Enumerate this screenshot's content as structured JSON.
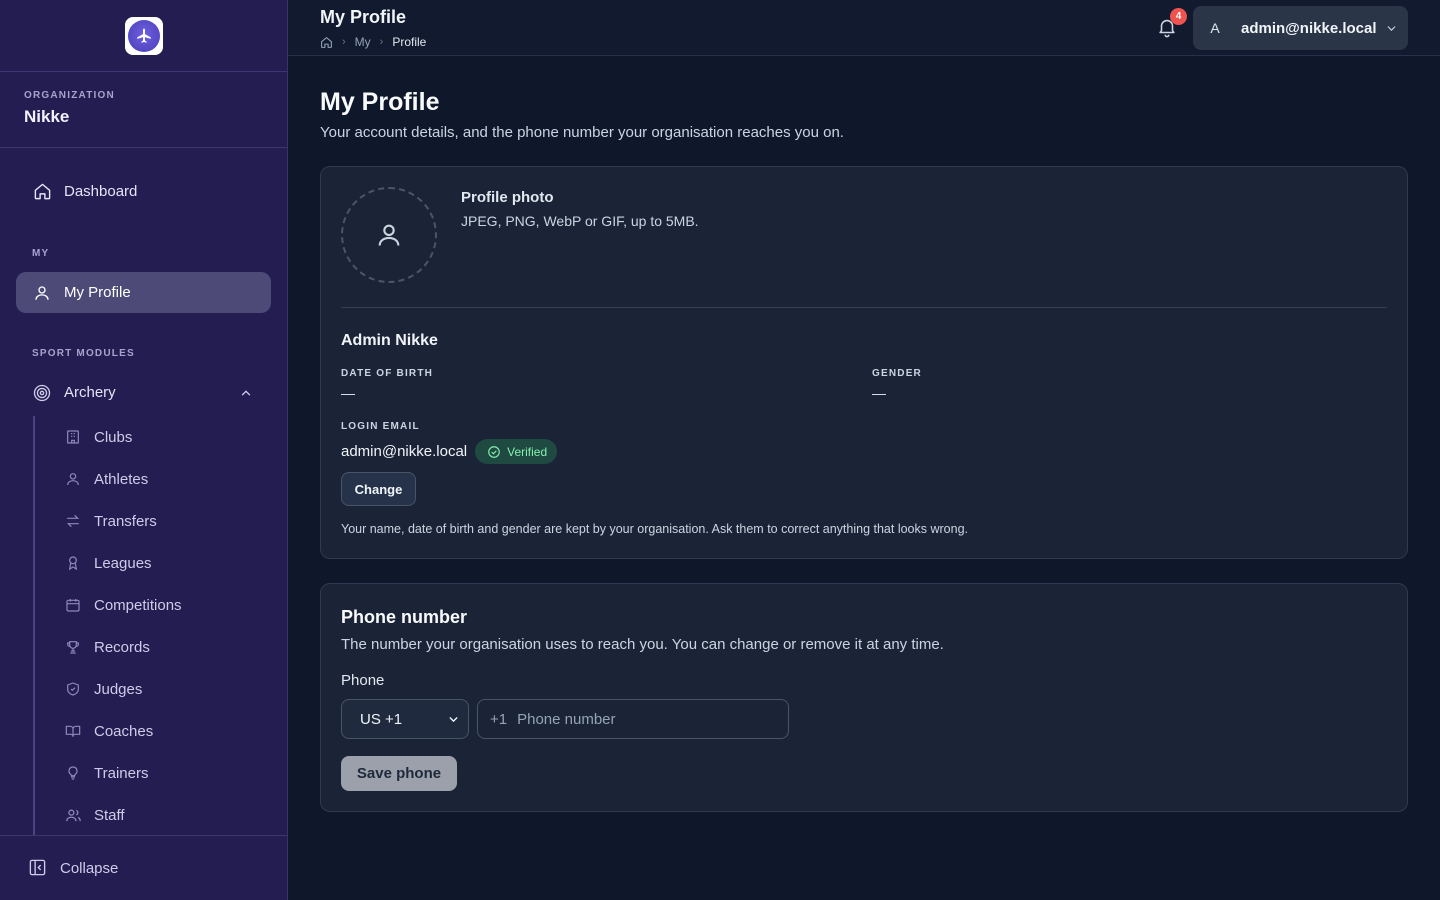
{
  "sidebar": {
    "org_label": "ORGANIZATION",
    "org_name": "Nikke",
    "dashboard": "Dashboard",
    "section_my": "MY",
    "my_profile": "My Profile",
    "section_sport": "SPORT MODULES",
    "archery": "Archery",
    "sub_items": [
      {
        "label": "Clubs",
        "icon": "building-icon"
      },
      {
        "label": "Athletes",
        "icon": "user-icon"
      },
      {
        "label": "Transfers",
        "icon": "arrows-icon"
      },
      {
        "label": "Leagues",
        "icon": "award-icon"
      },
      {
        "label": "Competitions",
        "icon": "calendar-icon"
      },
      {
        "label": "Records",
        "icon": "trophy-icon"
      },
      {
        "label": "Judges",
        "icon": "shield-icon"
      },
      {
        "label": "Coaches",
        "icon": "book-icon"
      },
      {
        "label": "Trainers",
        "icon": "lightbulb-icon"
      },
      {
        "label": "Staff",
        "icon": "users-icon"
      }
    ],
    "collapse": "Collapse"
  },
  "header": {
    "title": "My Profile",
    "breadcrumb": [
      "My",
      "Profile"
    ],
    "notification_count": "4",
    "avatar_initial": "A",
    "user_email": "admin@nikke.local"
  },
  "page": {
    "title": "My Profile",
    "subtitle": "Your account details, and the phone number your organisation reaches you on."
  },
  "profile": {
    "photo_title": "Profile photo",
    "photo_hint": "JPEG, PNG, WebP or GIF, up to 5MB.",
    "name": "Admin Nikke",
    "dob_label": "DATE OF BIRTH",
    "dob_value": "—",
    "gender_label": "GENDER",
    "gender_value": "—",
    "email_label": "LOGIN EMAIL",
    "email_value": "admin@nikke.local",
    "verified": "Verified",
    "change_button": "Change",
    "note": "Your name, date of birth and gender are kept by your organisation. Ask them to correct anything that looks wrong."
  },
  "phone": {
    "title": "Phone number",
    "subtitle": "The number your organisation uses to reach you. You can change or remove it at any time.",
    "label": "Phone",
    "country_value": "US +1",
    "prefix": "+1",
    "placeholder": "Phone number",
    "save_button": "Save phone"
  },
  "colors": {
    "sidebar_bg": "#231d52",
    "main_bg": "#0f172a",
    "card_bg": "#1b2436",
    "accent_active": "#4e4a78",
    "badge": "#ef5350",
    "verified": "#86efac"
  }
}
